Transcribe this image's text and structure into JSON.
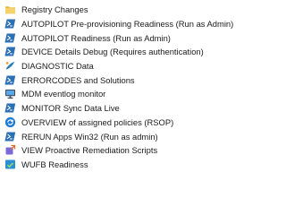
{
  "items": [
    {
      "label": "Registry Changes",
      "icon": "folder-icon"
    },
    {
      "label": "AUTOPILOT Pre-provisioning Readiness (Run as Admin)",
      "icon": "powershell-icon"
    },
    {
      "label": "AUTOPILOT Readiness (Run as Admin)",
      "icon": "powershell-icon"
    },
    {
      "label": "DEVICE Details Debug (Requires authentication)",
      "icon": "powershell-icon"
    },
    {
      "label": "DIAGNOSTIC Data",
      "icon": "diagnostic-icon"
    },
    {
      "label": "ERRORCODES and Solutions",
      "icon": "powershell-icon"
    },
    {
      "label": "MDM eventlog monitor",
      "icon": "monitor-icon"
    },
    {
      "label": "MONITOR Sync Data Live",
      "icon": "powershell-icon"
    },
    {
      "label": "OVERVIEW of assigned policies (RSOP)",
      "icon": "sync-icon"
    },
    {
      "label": "RERUN Apps Win32 (Run as admin)",
      "icon": "powershell-icon"
    },
    {
      "label": "VIEW Proactive Remediation Scripts",
      "icon": "remediation-icon"
    },
    {
      "label": "WUFB Readiness",
      "icon": "update-icon"
    }
  ]
}
